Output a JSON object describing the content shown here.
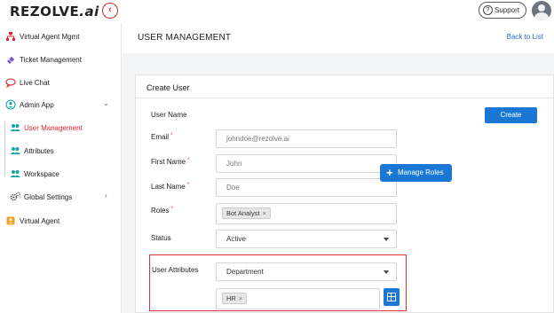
{
  "app": {
    "logo_text": "REZOLVE",
    "logo_suffix": ".ai",
    "support_label": "Support"
  },
  "sidebar": {
    "items": [
      {
        "label": "Virtual Agent Mgmt",
        "icon": "sitemap-icon"
      },
      {
        "label": "Ticket Management",
        "icon": "ticket-icon"
      },
      {
        "label": "Live Chat",
        "icon": "chat-icon"
      },
      {
        "label": "Admin App",
        "icon": "admin-icon"
      },
      {
        "label": "User Management",
        "icon": "users-icon",
        "active": true
      },
      {
        "label": "Attributes",
        "icon": "users-icon"
      },
      {
        "label": "Workspace",
        "icon": "users-icon"
      },
      {
        "label": "Global Settings",
        "icon": "gears-icon"
      },
      {
        "label": "Virtual Agent",
        "icon": "agent-icon"
      }
    ]
  },
  "header": {
    "title": "USER MANAGEMENT",
    "back_link": "Back to List"
  },
  "form": {
    "card_title": "Create User",
    "create_label": "Create",
    "manage_roles_label": "Manage Roles",
    "user_name_label": "User Name",
    "email_label": "Email",
    "email_value": "johndoe@rezolve.ai",
    "first_name_label": "First Name",
    "first_name_value": "John",
    "last_name_label": "Last Name",
    "last_name_value": "Doe",
    "roles_label": "Roles",
    "roles_chip": "Bot Analyst",
    "status_label": "Status",
    "status_value": "Active",
    "user_attributes_label": "User Attributes",
    "attribute_select": "Department",
    "attribute_chip": "HR",
    "required_mark": "*",
    "chip_remove": "×"
  },
  "colors": {
    "brand_red": "#e0242e",
    "primary_blue": "#1a78d4",
    "link_blue": "#2b6cc2"
  }
}
